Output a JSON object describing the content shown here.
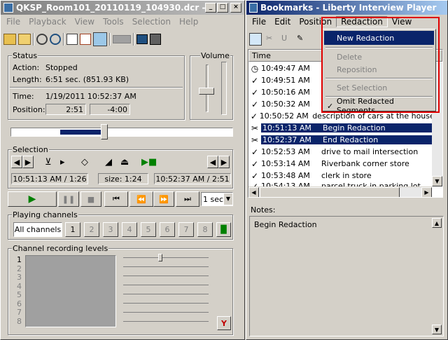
{
  "left_window": {
    "title": "QKSP_Room101_20110119_104930.dcr - Lib",
    "menu": [
      "File",
      "Playback",
      "View",
      "Tools",
      "Selection",
      "Help"
    ],
    "status": {
      "label": "Status",
      "action_label": "Action:",
      "action_value": "Stopped",
      "length_label": "Length:",
      "length_value": "6:51 sec. (851.93 KB)",
      "time_label": "Time:",
      "time_value": "1/19/2011 10:52:37 AM",
      "position_label": "Position:",
      "position_value": "2:51",
      "position_remaining": "-4:00"
    },
    "volume_label": "Volume",
    "selection": {
      "label": "Selection",
      "start": "10:51:13 AM / 1:26",
      "size": "size: 1:24",
      "end": "10:52:37 AM / 2:51"
    },
    "speed": "1 sec",
    "playing_channels": {
      "label": "Playing channels",
      "all_label": "All channels",
      "channels": [
        "1",
        "2",
        "3",
        "4",
        "5",
        "6",
        "7",
        "8"
      ]
    },
    "recording_levels": {
      "label": "Channel recording levels",
      "numbers": [
        "1",
        "2",
        "3",
        "4",
        "5",
        "6",
        "7",
        "8"
      ]
    }
  },
  "right_window": {
    "title": "Bookmarks - Liberty Interview Player",
    "menu": [
      "File",
      "Edit",
      "Position",
      "Redaction",
      "View"
    ],
    "column_time": "Time",
    "rows": [
      {
        "icon": "clock",
        "time": "10:49:47 AM",
        "text": ""
      },
      {
        "icon": "check",
        "time": "10:49:51 AM",
        "text": ""
      },
      {
        "icon": "check",
        "time": "10:50:16 AM",
        "text": ""
      },
      {
        "icon": "check",
        "time": "10:50:32 AM",
        "text": ""
      },
      {
        "icon": "check",
        "time": "10:50:52 AM",
        "text": "description of cars at the house o"
      },
      {
        "icon": "scissors",
        "time": "10:51:13 AM",
        "text": "Begin Redaction"
      },
      {
        "icon": "scissors",
        "time": "10:52:37 AM",
        "text": "End Redaction"
      },
      {
        "icon": "check",
        "time": "10:52:53 AM",
        "text": "drive to mail intersection"
      },
      {
        "icon": "check",
        "time": "10:53:14 AM",
        "text": "Riverbank corner store"
      },
      {
        "icon": "check",
        "time": "10:53:48 AM",
        "text": "clerk in store"
      },
      {
        "icon": "check",
        "time": "10:54:13 AM",
        "text": "parcel truck in parking lot"
      }
    ],
    "notes_label": "Notes:",
    "notes_value": "Begin Redaction",
    "redaction_menu": {
      "new": "New Redaction",
      "delete": "Delete",
      "reposition": "Reposition",
      "set_selection": "Set Selection",
      "omit": "Omit Redacted Segments"
    },
    "highlight_color": "#ff0000",
    "selection_color": "#0a246a"
  }
}
